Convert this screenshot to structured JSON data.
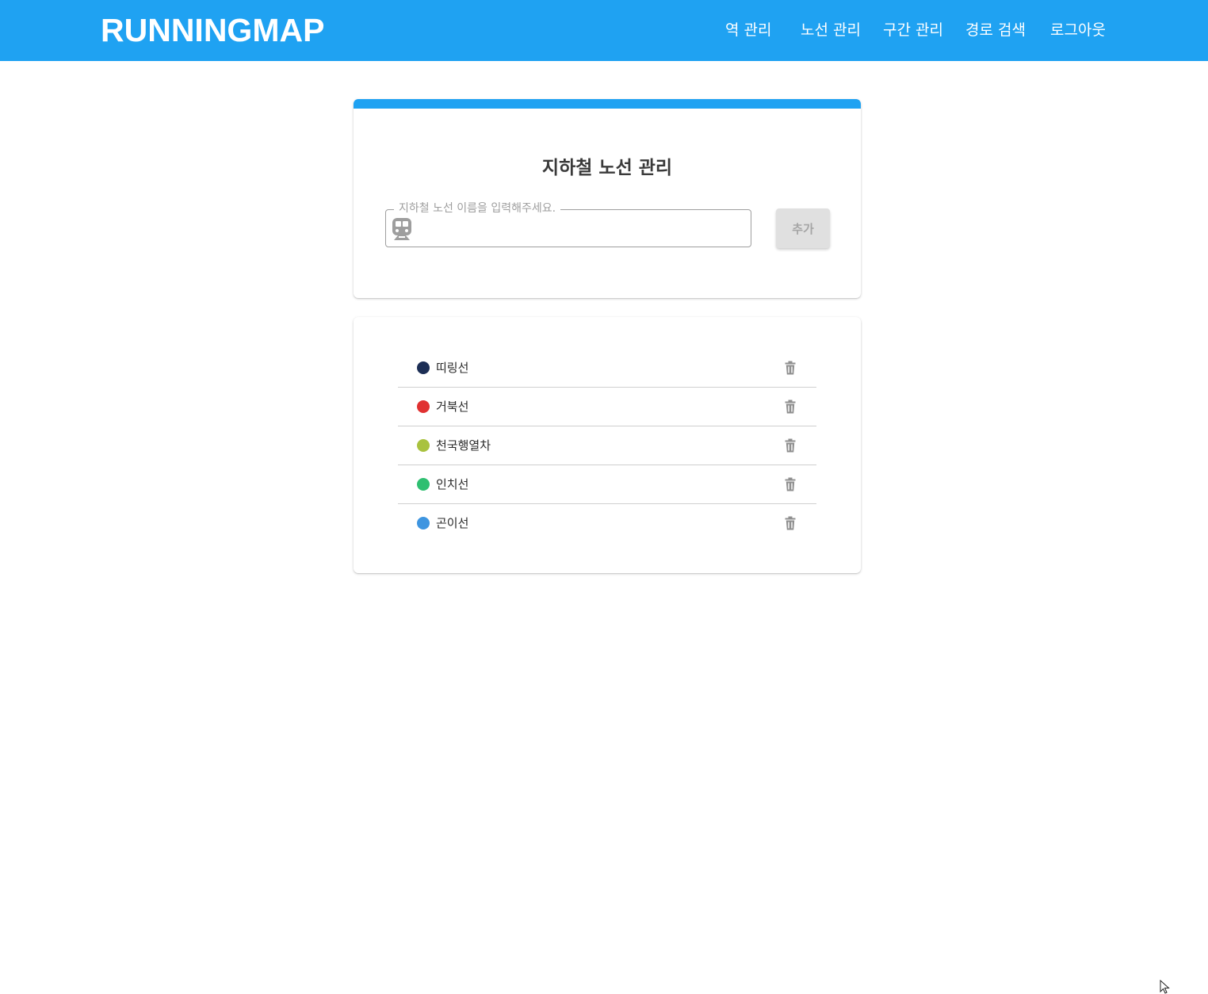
{
  "header": {
    "brand": "RUNNINGMAP",
    "nav": [
      {
        "label": "역 관리"
      },
      {
        "label": "노선 관리"
      },
      {
        "label": "구간 관리"
      },
      {
        "label": "경로 검색"
      },
      {
        "label": "로그아웃"
      }
    ]
  },
  "form": {
    "title": "지하철 노선 관리",
    "input_label": "지하철 노선 이름을 입력해주세요.",
    "input_value": "",
    "input_icon": "subway-icon",
    "add_label": "추가"
  },
  "lines": [
    {
      "name": "띠링선",
      "color": "#1c2e55"
    },
    {
      "name": "거북선",
      "color": "#e03131"
    },
    {
      "name": "천국행열차",
      "color": "#a9c23f"
    },
    {
      "name": "인치선",
      "color": "#2fbf71"
    },
    {
      "name": "곤이선",
      "color": "#3e95e0"
    }
  ],
  "colors": {
    "primary": "#1fa2f2",
    "button_bg": "#e0e0e0",
    "icon_gray": "#9e9e9e"
  }
}
